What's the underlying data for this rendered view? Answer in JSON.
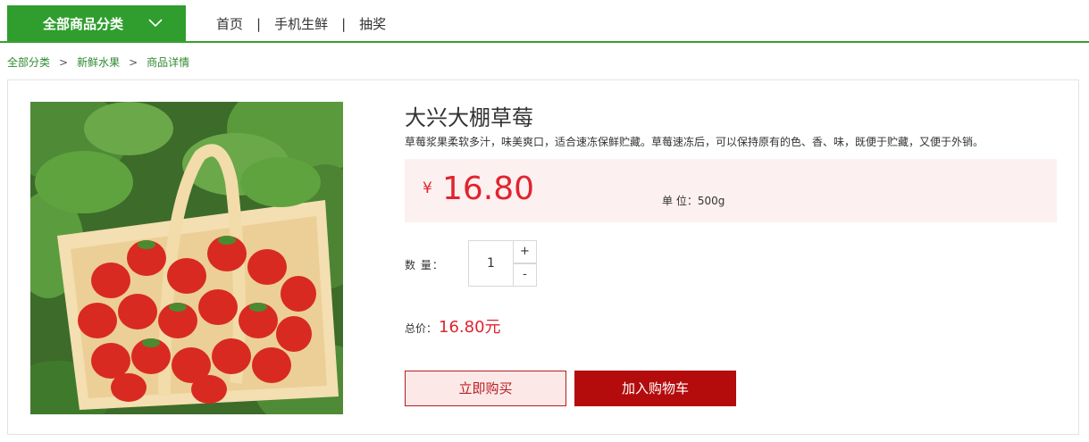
{
  "nav": {
    "category_button": "全部商品分类",
    "links": [
      "首页",
      "手机生鲜",
      "抽奖"
    ],
    "separator": "|"
  },
  "breadcrumb": {
    "items": [
      "全部分类",
      "新鲜水果",
      "商品详情"
    ],
    "separator": ">"
  },
  "product": {
    "title": "大兴大棚草莓",
    "description": "草莓浆果柔软多汁，味美爽口，适合速冻保鲜贮藏。草莓速冻后，可以保持原有的色、香、味，既便于贮藏，又便于外销。",
    "currency_symbol": "¥",
    "price": "16.80",
    "unit": "单 位：500g",
    "image_icon": "strawberry-basket-photo"
  },
  "quantity": {
    "label": "数 量：",
    "value": "1",
    "plus": "+",
    "minus": "-"
  },
  "total": {
    "label": "总价：",
    "amount": "16.80元"
  },
  "actions": {
    "buy_now": "立即购买",
    "add_to_cart": "加入购物车"
  },
  "colors": {
    "brand_green": "#2f9e2e",
    "price_red": "#e0242f",
    "cart_red": "#b40c0c"
  }
}
